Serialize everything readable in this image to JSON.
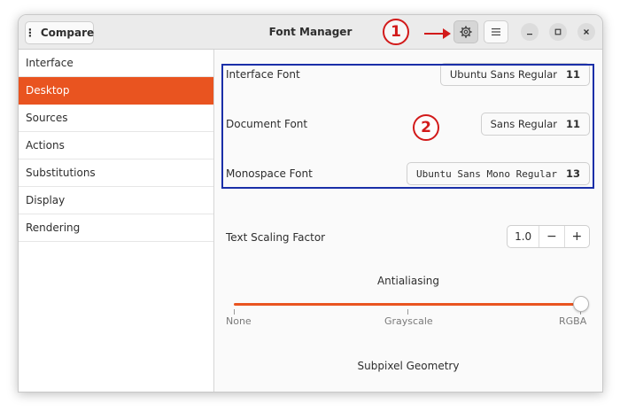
{
  "window": {
    "title": "Font Manager",
    "compare_label": "Compare",
    "compare_icon": "vertical-dots-icon"
  },
  "sidebar": {
    "items": [
      {
        "label": "Interface"
      },
      {
        "label": "Desktop",
        "active": true
      },
      {
        "label": "Sources"
      },
      {
        "label": "Actions"
      },
      {
        "label": "Substitutions"
      },
      {
        "label": "Display"
      },
      {
        "label": "Rendering"
      }
    ]
  },
  "desktop": {
    "interface_font": {
      "label": "Interface Font",
      "family": "Ubuntu Sans Regular",
      "size": "11"
    },
    "document_font": {
      "label": "Document Font",
      "family": "Sans Regular",
      "size": "11"
    },
    "monospace_font": {
      "label": "Monospace Font",
      "family": "Ubuntu Sans Mono Regular",
      "size": "13"
    },
    "scaling": {
      "label": "Text Scaling Factor",
      "value": "1.0",
      "minus": "−",
      "plus": "+"
    },
    "antialiasing": {
      "title": "Antialiasing",
      "labels": [
        "None",
        "Grayscale",
        "RGBA"
      ],
      "selected": "RGBA"
    },
    "subpixel": {
      "title": "Subpixel Geometry",
      "selected_index": 0
    }
  },
  "annotations": {
    "one": "1",
    "two": "2"
  },
  "colors": {
    "accent": "#e95420",
    "annotation_red": "#d21a1a",
    "annotation_blue": "#1a2fa8"
  }
}
